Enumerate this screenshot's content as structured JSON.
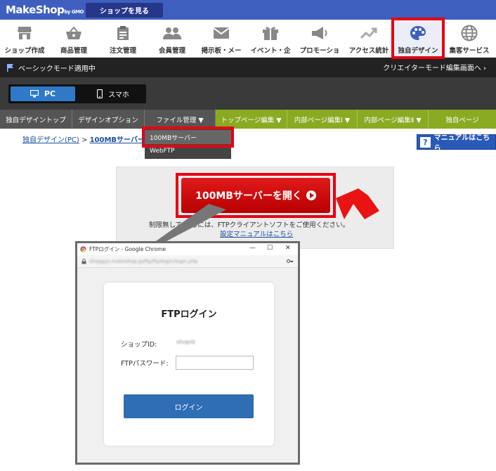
{
  "header": {
    "logo_text": "MakeShop",
    "logo_suffix": "by GMO",
    "shop_button": "ショップを見る"
  },
  "icon_nav": [
    {
      "label": "ショップ作成",
      "icon": "shop-icon"
    },
    {
      "label": "商品管理",
      "icon": "basket-icon"
    },
    {
      "label": "注文管理",
      "icon": "clipboard-icon"
    },
    {
      "label": "会員管理",
      "icon": "people-icon"
    },
    {
      "label": "掲示板・メー",
      "icon": "mail-icon"
    },
    {
      "label": "イベント・企",
      "icon": "gift-icon"
    },
    {
      "label": "プロモーショ",
      "icon": "megaphone-icon"
    },
    {
      "label": "アクセス統計",
      "icon": "chart-icon"
    },
    {
      "label": "独自デザイン",
      "icon": "palette-icon",
      "active": true
    },
    {
      "label": "集客サービス",
      "icon": "globe-icon"
    }
  ],
  "mode_bar": {
    "left_text": "ベーシックモード適用中",
    "right_text": "クリエイターモード編集画面へ ›"
  },
  "device": {
    "pc": "PC",
    "sp": "スマホ"
  },
  "menu": {
    "items": [
      "独自デザイントップ",
      "デザインオプション",
      "ファイル管理 ▼",
      "トップページ編集 ▼",
      "内部ページ編集Ⅰ ▼",
      "内部ページ編集Ⅱ ▼",
      "独自ページ"
    ],
    "dropdown": [
      "100MBサーバー",
      "WebFTP"
    ]
  },
  "breadcrumb": {
    "parent": "独自デザイン(PC)",
    "sep": ">",
    "current": "100MBサーバー"
  },
  "manual_button": "マニュアルはこちら",
  "content": {
    "open_button": "100MBサーバーを開く",
    "note": "制限無しで                     するには、FTPクライアントソフトをご使用ください。",
    "note_link": "設定マニュアルはこちら"
  },
  "popup": {
    "window_title": "FTPログイン - Google Chrome",
    "address": "shopgyo.makeshop.jp/ftp/ftp/login/login.php",
    "title": "FTPログイン",
    "shop_id_label": "ショップID:",
    "shop_id_value": "shopid",
    "password_label": "FTPパスワード:",
    "login_button": "ログイン"
  },
  "colors": {
    "header_blue": "#3f5fbf",
    "highlight_red": "#e60012",
    "menu_green": "#8aaa22",
    "login_blue": "#2f6db5"
  }
}
